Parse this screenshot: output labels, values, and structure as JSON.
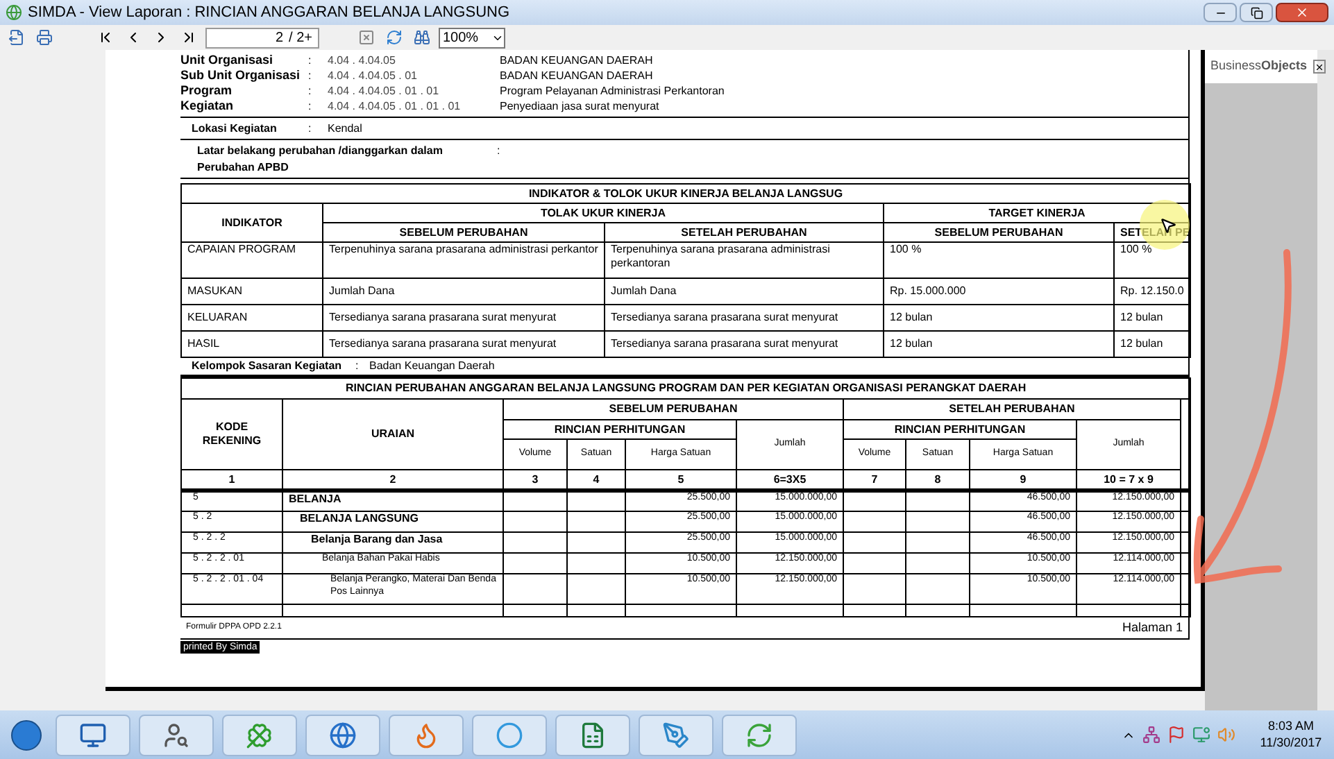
{
  "window": {
    "title": "SIMDA - View Laporan : RINCIAN ANGGARAN BELANJA LANGSUNG"
  },
  "toolbar": {
    "page_field": "2",
    "page_total": "/ 2+",
    "zoom": "100%"
  },
  "logo": "Business**Objects**",
  "report": {
    "info_rows": [
      {
        "label": "Unit Organisasi",
        "separator": ":",
        "code": "4.04 . 4.04.05",
        "name": "BADAN KEUANGAN DAERAH"
      },
      {
        "label": "Sub Unit Organisasi",
        "separator": ":",
        "code": "4.04 . 4.04.05 . 01",
        "name": "BADAN KEUANGAN DAERAH"
      },
      {
        "label": "Program",
        "separator": ":",
        "code": "4.04 . 4.04.05 . 01 . 01",
        "name": "Program Pelayanan Administrasi Perkantoran"
      },
      {
        "label": "Kegiatan",
        "separator": ":",
        "code": "4.04 . 4.04.05 . 01 . 01 . 01",
        "name": "Penyediaan jasa surat menyurat"
      }
    ],
    "location": {
      "label": "Lokasi Kegiatan",
      "separator": ":",
      "value": "Kendal"
    },
    "background": {
      "label": "Latar belakang perubahan /dianggarkan dalam",
      "separator": ":",
      "label_2": "Perubahan APBD"
    },
    "indicator_table": {
      "title": "INDIKATOR & TOLOK UKUR KINERJA  BELANJA LANGSUG",
      "col_indikator": "INDIKATOR",
      "group_tolok": "TOLAK UKUR KINERJA",
      "group_target": "TARGET KINERJA",
      "sub_headers": [
        "SEBELUM PERUBAHAN",
        "SETELAH PERUBAHAN",
        "SEBELUM PERUBAHAN",
        "SETELAH PE"
      ],
      "rows": [
        {
          "indikator": "CAPAIAN PROGRAM",
          "tolok_sebelum": "Terpenuhinya sarana prasarana administrasi perkantor",
          "tolok_setelah": "Terpenuhinya sarana prasarana administrasi perkantoran",
          "target_sebelum": "100 %",
          "target_setelah": "100 %"
        },
        {
          "indikator": "MASUKAN",
          "tolok_sebelum": "Jumlah Dana",
          "tolok_setelah": "Jumlah Dana",
          "target_sebelum": "Rp. 15.000.000",
          "target_setelah": "Rp. 12.150.0"
        },
        {
          "indikator": "KELUARAN",
          "tolok_sebelum": "Tersedianya sarana prasarana surat menyurat",
          "tolok_setelah": "Tersedianya sarana prasarana surat menyurat",
          "target_sebelum": "12 bulan",
          "target_setelah": "12 bulan"
        },
        {
          "indikator": "HASIL",
          "tolok_sebelum": "Tersedianya sarana prasarana surat menyurat",
          "tolok_setelah": "Tersedianya sarana prasarana surat menyurat",
          "target_sebelum": "12 bulan",
          "target_setelah": "12 bulan"
        }
      ]
    },
    "target_group": {
      "label": "Kelompok Sasaran Kegiatan",
      "separator": ":",
      "value": "Badan Keuangan Daerah"
    },
    "budget_table": {
      "title": "RINCIAN PERUBAHAN ANGGARAN BELANJA LANGSUNG PROGRAM DAN PER KEGIATAN ORGANISASI PERANGKAT DAERAH",
      "col_kode": "KODE REKENING",
      "col_uraian": "URAIAN",
      "group_sebelum": "SEBELUM PERUBAHAN",
      "group_setelah": "SETELAH PERUBAHAN",
      "rincian_sebelum": "RINCIAN PERHITUNGAN",
      "rincian_setelah": "RINCIAN PERHITUNGAN",
      "detail_headers_sebelum": [
        "Volume",
        "Satuan",
        "Harga Satuan"
      ],
      "jumlah_sebelum": "Jumlah",
      "detail_headers_setelah": [
        "Volume",
        "Satuan",
        "Harga Satuan"
      ],
      "jumlah_setelah": "Jumlah",
      "column_numbers": [
        "1",
        "2",
        "3",
        "4",
        "5",
        "6=3X5",
        "7",
        "8",
        "9",
        "10 = 7 x 9"
      ],
      "rows": [
        {
          "kode": "5",
          "uraian": "BELANJA",
          "harga_sebelum": "25.500,00",
          "jumlah_sebelum": "15.000.000,00",
          "harga_setelah": "46.500,00",
          "jumlah_setelah": "12.150.000,00",
          "children": [
            {
              "kode": "5 . 2",
              "uraian": "BELANJA LANGSUNG",
              "harga_sebelum": "25.500,00",
              "jumlah_sebelum": "15.000.000,00",
              "harga_setelah": "46.500,00",
              "jumlah_setelah": "12.150.000,00",
              "children": [
                {
                  "kode": "5 . 2 . 2",
                  "uraian": "Belanja Barang dan Jasa",
                  "harga_sebelum": "25.500,00",
                  "jumlah_sebelum": "15.000.000,00",
                  "harga_setelah": "46.500,00",
                  "jumlah_setelah": "12.150.000,00",
                  "children": [
                    {
                      "kode": "5 . 2 . 2 . 01",
                      "uraian": "Belanja Bahan Pakai Habis",
                      "harga_sebelum": "10.500,00",
                      "jumlah_sebelum": "12.150.000,00",
                      "harga_setelah": "10.500,00",
                      "jumlah_setelah": "12.114.000,00",
                      "children": [
                        {
                          "kode": "5 . 2 . 2 . 01 . 04",
                          "uraian": "Belanja Perangko, Materai Dan Benda Pos Lainnya",
                          "harga_sebelum": "10.500,00",
                          "jumlah_sebelum": "12.150.000,00",
                          "harga_setelah": "10.500,00",
                          "jumlah_setelah": "12.114.000,00"
                        }
                      ]
                    }
                  ]
                }
              ]
            }
          ]
        }
      ]
    },
    "footer": {
      "form": "Formulir DPPA OPD 2.2.1",
      "page": "Halaman 1",
      "printed": "printed By Simda"
    }
  },
  "taskbar": {
    "time": "8:03 AM",
    "date": "11/30/2017"
  }
}
